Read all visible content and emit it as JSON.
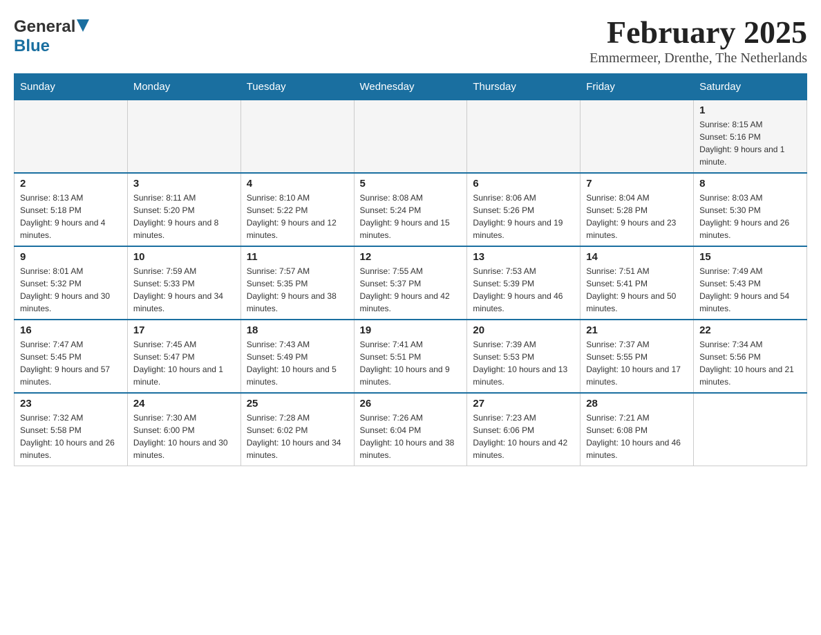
{
  "header": {
    "logo_general": "General",
    "logo_blue": "Blue",
    "month_title": "February 2025",
    "location": "Emmermeer, Drenthe, The Netherlands"
  },
  "days_of_week": [
    "Sunday",
    "Monday",
    "Tuesday",
    "Wednesday",
    "Thursday",
    "Friday",
    "Saturday"
  ],
  "weeks": [
    [
      {
        "day": "",
        "info": ""
      },
      {
        "day": "",
        "info": ""
      },
      {
        "day": "",
        "info": ""
      },
      {
        "day": "",
        "info": ""
      },
      {
        "day": "",
        "info": ""
      },
      {
        "day": "",
        "info": ""
      },
      {
        "day": "1",
        "info": "Sunrise: 8:15 AM\nSunset: 5:16 PM\nDaylight: 9 hours and 1 minute."
      }
    ],
    [
      {
        "day": "2",
        "info": "Sunrise: 8:13 AM\nSunset: 5:18 PM\nDaylight: 9 hours and 4 minutes."
      },
      {
        "day": "3",
        "info": "Sunrise: 8:11 AM\nSunset: 5:20 PM\nDaylight: 9 hours and 8 minutes."
      },
      {
        "day": "4",
        "info": "Sunrise: 8:10 AM\nSunset: 5:22 PM\nDaylight: 9 hours and 12 minutes."
      },
      {
        "day": "5",
        "info": "Sunrise: 8:08 AM\nSunset: 5:24 PM\nDaylight: 9 hours and 15 minutes."
      },
      {
        "day": "6",
        "info": "Sunrise: 8:06 AM\nSunset: 5:26 PM\nDaylight: 9 hours and 19 minutes."
      },
      {
        "day": "7",
        "info": "Sunrise: 8:04 AM\nSunset: 5:28 PM\nDaylight: 9 hours and 23 minutes."
      },
      {
        "day": "8",
        "info": "Sunrise: 8:03 AM\nSunset: 5:30 PM\nDaylight: 9 hours and 26 minutes."
      }
    ],
    [
      {
        "day": "9",
        "info": "Sunrise: 8:01 AM\nSunset: 5:32 PM\nDaylight: 9 hours and 30 minutes."
      },
      {
        "day": "10",
        "info": "Sunrise: 7:59 AM\nSunset: 5:33 PM\nDaylight: 9 hours and 34 minutes."
      },
      {
        "day": "11",
        "info": "Sunrise: 7:57 AM\nSunset: 5:35 PM\nDaylight: 9 hours and 38 minutes."
      },
      {
        "day": "12",
        "info": "Sunrise: 7:55 AM\nSunset: 5:37 PM\nDaylight: 9 hours and 42 minutes."
      },
      {
        "day": "13",
        "info": "Sunrise: 7:53 AM\nSunset: 5:39 PM\nDaylight: 9 hours and 46 minutes."
      },
      {
        "day": "14",
        "info": "Sunrise: 7:51 AM\nSunset: 5:41 PM\nDaylight: 9 hours and 50 minutes."
      },
      {
        "day": "15",
        "info": "Sunrise: 7:49 AM\nSunset: 5:43 PM\nDaylight: 9 hours and 54 minutes."
      }
    ],
    [
      {
        "day": "16",
        "info": "Sunrise: 7:47 AM\nSunset: 5:45 PM\nDaylight: 9 hours and 57 minutes."
      },
      {
        "day": "17",
        "info": "Sunrise: 7:45 AM\nSunset: 5:47 PM\nDaylight: 10 hours and 1 minute."
      },
      {
        "day": "18",
        "info": "Sunrise: 7:43 AM\nSunset: 5:49 PM\nDaylight: 10 hours and 5 minutes."
      },
      {
        "day": "19",
        "info": "Sunrise: 7:41 AM\nSunset: 5:51 PM\nDaylight: 10 hours and 9 minutes."
      },
      {
        "day": "20",
        "info": "Sunrise: 7:39 AM\nSunset: 5:53 PM\nDaylight: 10 hours and 13 minutes."
      },
      {
        "day": "21",
        "info": "Sunrise: 7:37 AM\nSunset: 5:55 PM\nDaylight: 10 hours and 17 minutes."
      },
      {
        "day": "22",
        "info": "Sunrise: 7:34 AM\nSunset: 5:56 PM\nDaylight: 10 hours and 21 minutes."
      }
    ],
    [
      {
        "day": "23",
        "info": "Sunrise: 7:32 AM\nSunset: 5:58 PM\nDaylight: 10 hours and 26 minutes."
      },
      {
        "day": "24",
        "info": "Sunrise: 7:30 AM\nSunset: 6:00 PM\nDaylight: 10 hours and 30 minutes."
      },
      {
        "day": "25",
        "info": "Sunrise: 7:28 AM\nSunset: 6:02 PM\nDaylight: 10 hours and 34 minutes."
      },
      {
        "day": "26",
        "info": "Sunrise: 7:26 AM\nSunset: 6:04 PM\nDaylight: 10 hours and 38 minutes."
      },
      {
        "day": "27",
        "info": "Sunrise: 7:23 AM\nSunset: 6:06 PM\nDaylight: 10 hours and 42 minutes."
      },
      {
        "day": "28",
        "info": "Sunrise: 7:21 AM\nSunset: 6:08 PM\nDaylight: 10 hours and 46 minutes."
      },
      {
        "day": "",
        "info": ""
      }
    ]
  ]
}
